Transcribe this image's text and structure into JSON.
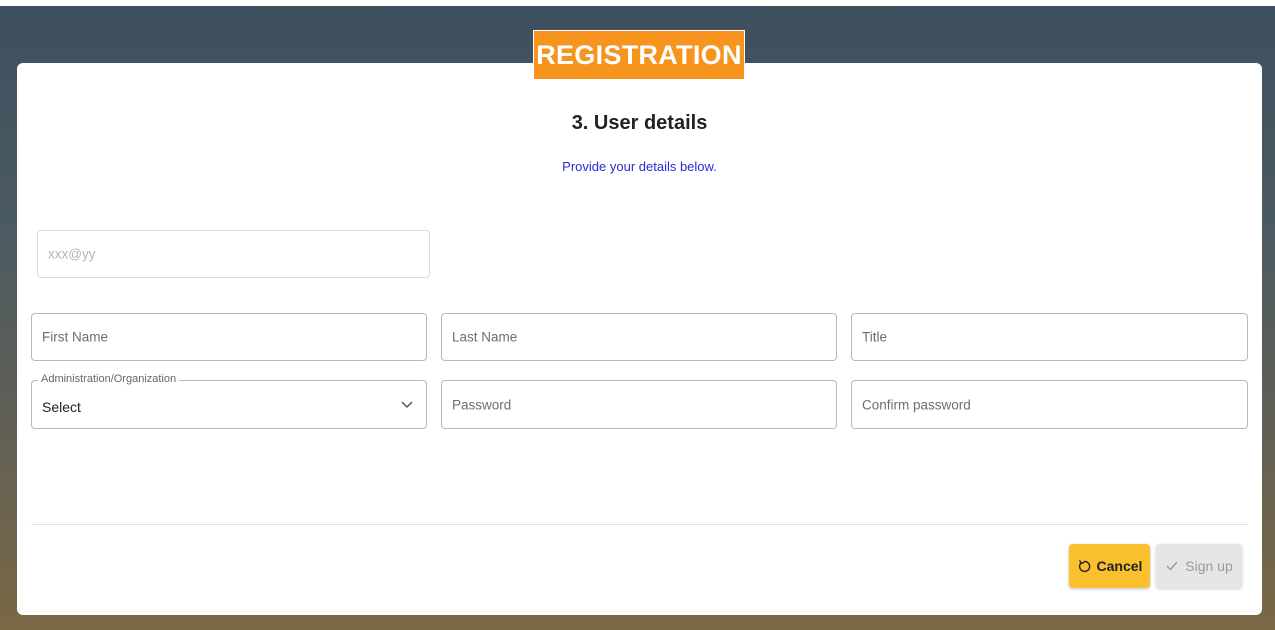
{
  "header": {
    "badge": "REGISTRATION"
  },
  "step": {
    "title": "3. User details",
    "subtitle": "Provide your details below."
  },
  "form": {
    "email_placeholder": "xxx@yy",
    "first_name_placeholder": "First Name",
    "last_name_placeholder": "Last Name",
    "title_placeholder": "Title",
    "organization_label": "Administration/Organization",
    "organization_value": "Select",
    "password_placeholder": "Password",
    "confirm_password_placeholder": "Confirm password"
  },
  "actions": {
    "cancel_label": "Cancel",
    "cancel_icon": "undo-icon",
    "signup_label": "Sign up",
    "signup_icon": "check-icon"
  },
  "colors": {
    "badge": "#f7941d",
    "subtitle": "#2b2bd6",
    "cancel_button": "#fbc02d",
    "signup_button_disabled": "#e6e6e6"
  }
}
